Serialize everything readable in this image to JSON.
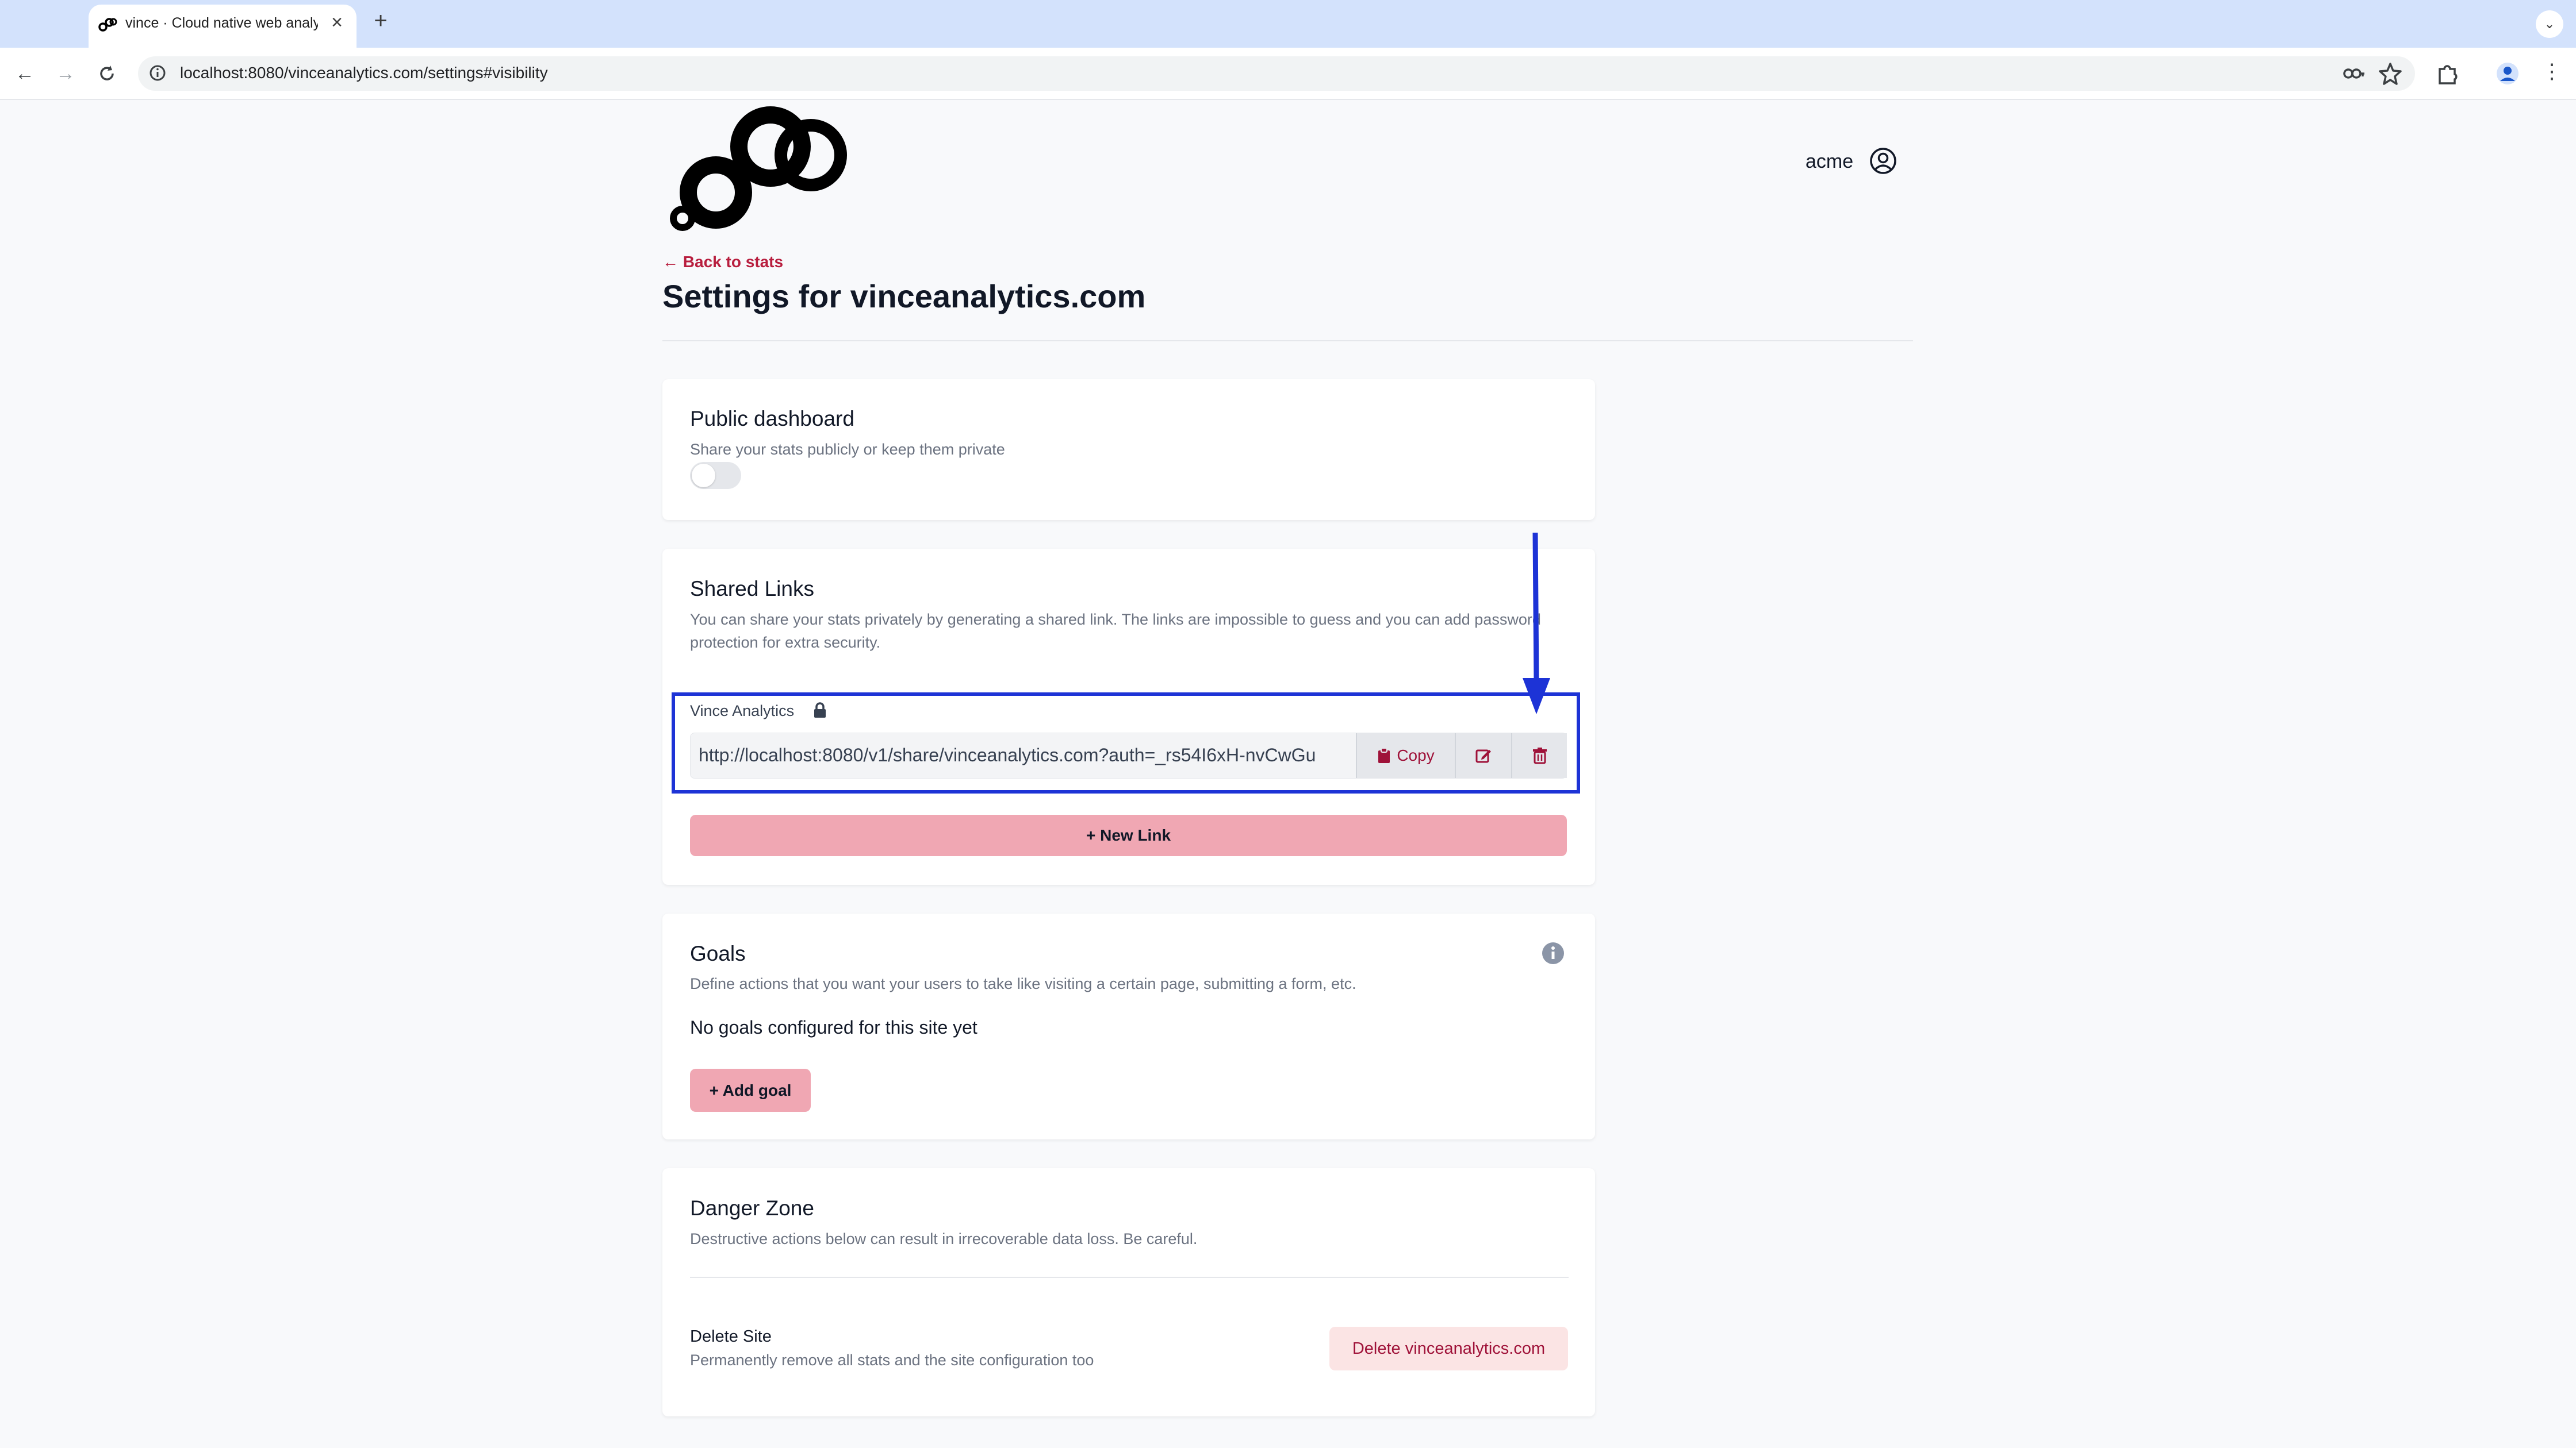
{
  "browser": {
    "tab_title": "vince · Cloud native web analytics",
    "url": "localhost:8080/vinceanalytics.com/settings#visibility"
  },
  "header": {
    "username": "acme"
  },
  "page": {
    "back_link": "← Back to stats",
    "title": "Settings for vinceanalytics.com"
  },
  "public_dashboard": {
    "title": "Public dashboard",
    "description": "Share your stats publicly or keep them private",
    "enabled": false
  },
  "shared_links": {
    "title": "Shared Links",
    "description": "You can share your stats privately by generating a shared link. The links are impossible to guess and you can add password protection for extra security.",
    "links": [
      {
        "name": "Vince Analytics",
        "url": "http://localhost:8080/v1/share/vinceanalytics.com?auth=_rs54I6xH-nvCwGu",
        "copy_label": "Copy"
      }
    ],
    "new_link_label": "+ New Link"
  },
  "goals": {
    "title": "Goals",
    "description": "Define actions that you want your users to take like visiting a certain page, submitting a form, etc.",
    "empty_text": "No goals configured for this site yet",
    "add_label": "+ Add goal"
  },
  "danger_zone": {
    "title": "Danger Zone",
    "description": "Destructive actions below can result in irrecoverable data loss. Be careful.",
    "delete_title": "Delete Site",
    "delete_description": "Permanently remove all stats and the site configuration too",
    "delete_button": "Delete vinceanalytics.com"
  },
  "colors": {
    "accent": "#b81e3e",
    "button_pink": "#f0a7b3",
    "annotation": "#1d33d6"
  }
}
